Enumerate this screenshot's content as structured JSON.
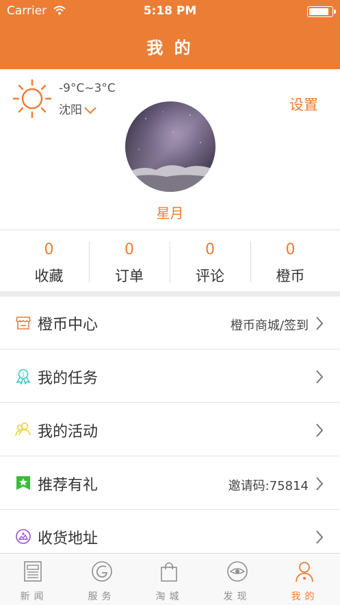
{
  "status_bar": {
    "carrier": "Carrier",
    "time": "5:18 PM",
    "battery_level": 0.9
  },
  "nav": {
    "title": "我 的"
  },
  "profile": {
    "weather_icon": "sun-icon",
    "temperature": "-9°C~3°C",
    "city": "沈阳",
    "settings_label": "设置",
    "username": "星月"
  },
  "stats": [
    {
      "value": "0",
      "label": "收藏"
    },
    {
      "value": "0",
      "label": "订单"
    },
    {
      "value": "0",
      "label": "评论"
    },
    {
      "value": "0",
      "label": "橙币"
    }
  ],
  "menu": [
    {
      "icon": "shop-icon",
      "label": "橙币中心",
      "extra": "橙币商城/签到"
    },
    {
      "icon": "medal-icon",
      "label": "我的任务",
      "extra": ""
    },
    {
      "icon": "people-icon",
      "label": "我的活动",
      "extra": ""
    },
    {
      "icon": "star-flag-icon",
      "label": "推荐有礼",
      "extra": "邀请码:75814"
    },
    {
      "icon": "address-icon",
      "label": "收货地址",
      "extra": ""
    }
  ],
  "tabs": [
    {
      "icon": "news-icon",
      "label": "新闻"
    },
    {
      "icon": "service-icon",
      "label": "服务"
    },
    {
      "icon": "bag-icon",
      "label": "淘城"
    },
    {
      "icon": "eye-icon",
      "label": "发现"
    },
    {
      "icon": "person-icon",
      "label": "我的",
      "active": true
    }
  ],
  "colors": {
    "accent": "#ec7d35",
    "divider": "#e2e2e2"
  }
}
